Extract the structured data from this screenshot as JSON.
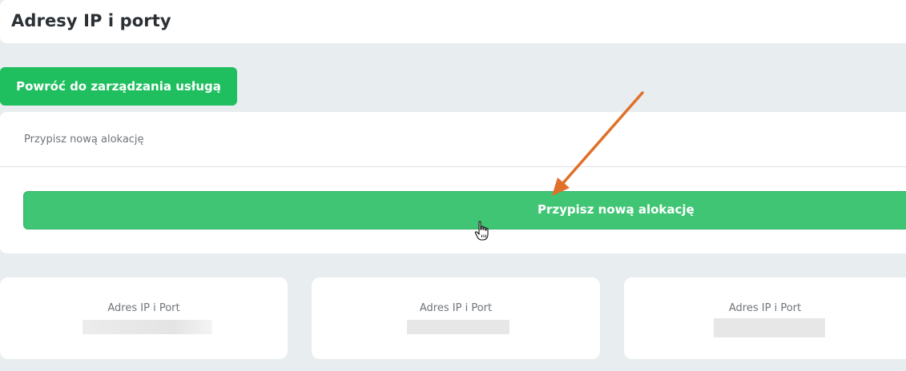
{
  "header": {
    "title": "Adresy IP i porty"
  },
  "back_button": {
    "label": "Powróć do zarządzania usługą"
  },
  "allocation_card": {
    "title": "Przypisz nową alokację",
    "assign_button_label": "Przypisz nową alokację"
  },
  "ip_cards": [
    {
      "label": "Adres IP i Port"
    },
    {
      "label": "Adres IP i Port"
    },
    {
      "label": "Adres IP i Port"
    }
  ],
  "colors": {
    "back_button": "#1fbf5f",
    "assign_button": "#40c574",
    "annotation_arrow": "#e0702a",
    "background": "#e8edf0"
  },
  "icons": {
    "cursor": "hand-pointer-icon",
    "annotation": "arrow-annotation"
  }
}
